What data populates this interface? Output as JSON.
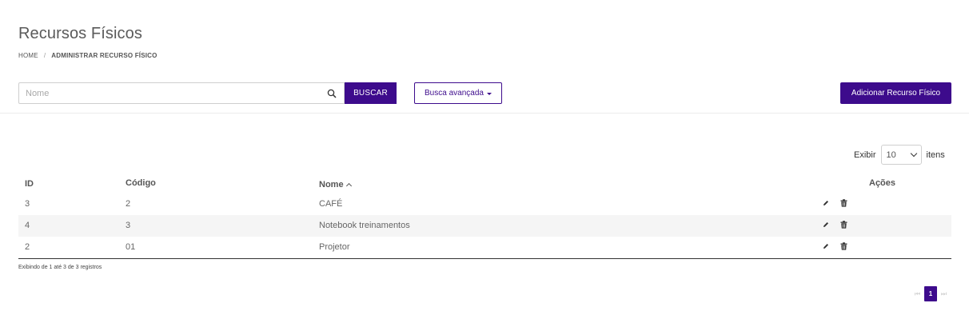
{
  "header": {
    "title": "Recursos Físicos",
    "breadcrumb": {
      "home": "HOME",
      "separator": "/",
      "current": "ADMINISTRAR RECURSO FÍSICO"
    }
  },
  "toolbar": {
    "search_placeholder": "Nome",
    "search_value": "",
    "search_button": "BUSCAR",
    "advanced_button": "Busca avançada",
    "add_button": "Adicionar Recurso Físico"
  },
  "page_size": {
    "prefix": "Exibir",
    "value": "10",
    "suffix": "itens"
  },
  "table": {
    "headers": {
      "id": "ID",
      "code": "Código",
      "name": "Nome",
      "actions": "Ações"
    },
    "rows": [
      {
        "id": "3",
        "code": "2",
        "name": "CAFÉ"
      },
      {
        "id": "4",
        "code": "3",
        "name": "Notebook treinamentos"
      },
      {
        "id": "2",
        "code": "01",
        "name": "Projetor"
      }
    ]
  },
  "footer": {
    "records_info": "Exibindo de 1 até 3 de 3 registros"
  },
  "pagination": {
    "current_page": "1",
    "first_symbol": "⏮",
    "last_symbol": "⏭"
  },
  "colors": {
    "primary": "#3d0b8c",
    "row_alt": "#f5f5f5"
  }
}
